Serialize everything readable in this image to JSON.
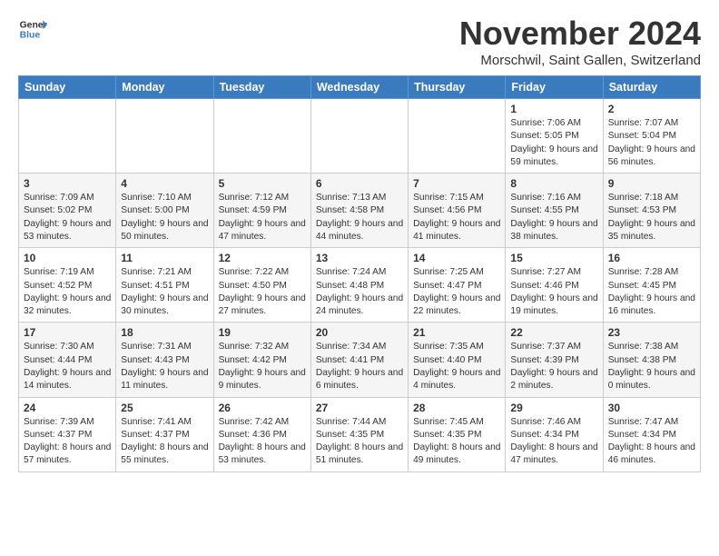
{
  "header": {
    "logo_line1": "General",
    "logo_line2": "Blue",
    "month": "November 2024",
    "location": "Morschwil, Saint Gallen, Switzerland"
  },
  "weekdays": [
    "Sunday",
    "Monday",
    "Tuesday",
    "Wednesday",
    "Thursday",
    "Friday",
    "Saturday"
  ],
  "weeks": [
    [
      {
        "day": "",
        "text": ""
      },
      {
        "day": "",
        "text": ""
      },
      {
        "day": "",
        "text": ""
      },
      {
        "day": "",
        "text": ""
      },
      {
        "day": "",
        "text": ""
      },
      {
        "day": "1",
        "text": "Sunrise: 7:06 AM\nSunset: 5:05 PM\nDaylight: 9 hours and 59 minutes."
      },
      {
        "day": "2",
        "text": "Sunrise: 7:07 AM\nSunset: 5:04 PM\nDaylight: 9 hours and 56 minutes."
      }
    ],
    [
      {
        "day": "3",
        "text": "Sunrise: 7:09 AM\nSunset: 5:02 PM\nDaylight: 9 hours and 53 minutes."
      },
      {
        "day": "4",
        "text": "Sunrise: 7:10 AM\nSunset: 5:00 PM\nDaylight: 9 hours and 50 minutes."
      },
      {
        "day": "5",
        "text": "Sunrise: 7:12 AM\nSunset: 4:59 PM\nDaylight: 9 hours and 47 minutes."
      },
      {
        "day": "6",
        "text": "Sunrise: 7:13 AM\nSunset: 4:58 PM\nDaylight: 9 hours and 44 minutes."
      },
      {
        "day": "7",
        "text": "Sunrise: 7:15 AM\nSunset: 4:56 PM\nDaylight: 9 hours and 41 minutes."
      },
      {
        "day": "8",
        "text": "Sunrise: 7:16 AM\nSunset: 4:55 PM\nDaylight: 9 hours and 38 minutes."
      },
      {
        "day": "9",
        "text": "Sunrise: 7:18 AM\nSunset: 4:53 PM\nDaylight: 9 hours and 35 minutes."
      }
    ],
    [
      {
        "day": "10",
        "text": "Sunrise: 7:19 AM\nSunset: 4:52 PM\nDaylight: 9 hours and 32 minutes."
      },
      {
        "day": "11",
        "text": "Sunrise: 7:21 AM\nSunset: 4:51 PM\nDaylight: 9 hours and 30 minutes."
      },
      {
        "day": "12",
        "text": "Sunrise: 7:22 AM\nSunset: 4:50 PM\nDaylight: 9 hours and 27 minutes."
      },
      {
        "day": "13",
        "text": "Sunrise: 7:24 AM\nSunset: 4:48 PM\nDaylight: 9 hours and 24 minutes."
      },
      {
        "day": "14",
        "text": "Sunrise: 7:25 AM\nSunset: 4:47 PM\nDaylight: 9 hours and 22 minutes."
      },
      {
        "day": "15",
        "text": "Sunrise: 7:27 AM\nSunset: 4:46 PM\nDaylight: 9 hours and 19 minutes."
      },
      {
        "day": "16",
        "text": "Sunrise: 7:28 AM\nSunset: 4:45 PM\nDaylight: 9 hours and 16 minutes."
      }
    ],
    [
      {
        "day": "17",
        "text": "Sunrise: 7:30 AM\nSunset: 4:44 PM\nDaylight: 9 hours and 14 minutes."
      },
      {
        "day": "18",
        "text": "Sunrise: 7:31 AM\nSunset: 4:43 PM\nDaylight: 9 hours and 11 minutes."
      },
      {
        "day": "19",
        "text": "Sunrise: 7:32 AM\nSunset: 4:42 PM\nDaylight: 9 hours and 9 minutes."
      },
      {
        "day": "20",
        "text": "Sunrise: 7:34 AM\nSunset: 4:41 PM\nDaylight: 9 hours and 6 minutes."
      },
      {
        "day": "21",
        "text": "Sunrise: 7:35 AM\nSunset: 4:40 PM\nDaylight: 9 hours and 4 minutes."
      },
      {
        "day": "22",
        "text": "Sunrise: 7:37 AM\nSunset: 4:39 PM\nDaylight: 9 hours and 2 minutes."
      },
      {
        "day": "23",
        "text": "Sunrise: 7:38 AM\nSunset: 4:38 PM\nDaylight: 9 hours and 0 minutes."
      }
    ],
    [
      {
        "day": "24",
        "text": "Sunrise: 7:39 AM\nSunset: 4:37 PM\nDaylight: 8 hours and 57 minutes."
      },
      {
        "day": "25",
        "text": "Sunrise: 7:41 AM\nSunset: 4:37 PM\nDaylight: 8 hours and 55 minutes."
      },
      {
        "day": "26",
        "text": "Sunrise: 7:42 AM\nSunset: 4:36 PM\nDaylight: 8 hours and 53 minutes."
      },
      {
        "day": "27",
        "text": "Sunrise: 7:44 AM\nSunset: 4:35 PM\nDaylight: 8 hours and 51 minutes."
      },
      {
        "day": "28",
        "text": "Sunrise: 7:45 AM\nSunset: 4:35 PM\nDaylight: 8 hours and 49 minutes."
      },
      {
        "day": "29",
        "text": "Sunrise: 7:46 AM\nSunset: 4:34 PM\nDaylight: 8 hours and 47 minutes."
      },
      {
        "day": "30",
        "text": "Sunrise: 7:47 AM\nSunset: 4:34 PM\nDaylight: 8 hours and 46 minutes."
      }
    ]
  ]
}
